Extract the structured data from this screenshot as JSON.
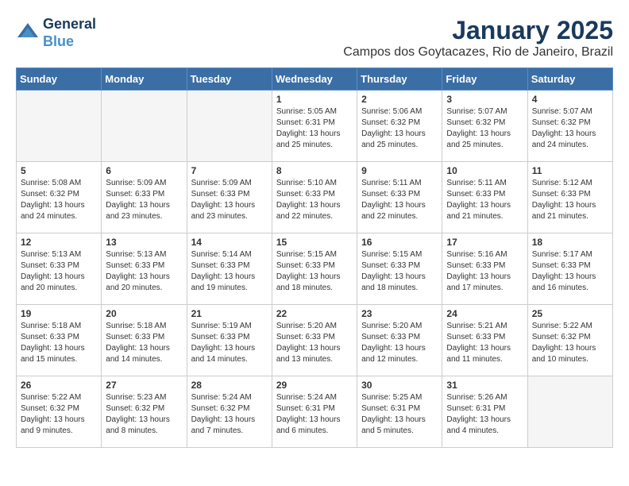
{
  "header": {
    "logo_line1": "General",
    "logo_line2": "Blue",
    "month_title": "January 2025",
    "location": "Campos dos Goytacazes, Rio de Janeiro, Brazil"
  },
  "weekdays": [
    "Sunday",
    "Monday",
    "Tuesday",
    "Wednesday",
    "Thursday",
    "Friday",
    "Saturday"
  ],
  "weeks": [
    [
      {
        "day": "",
        "info": ""
      },
      {
        "day": "",
        "info": ""
      },
      {
        "day": "",
        "info": ""
      },
      {
        "day": "1",
        "info": "Sunrise: 5:05 AM\nSunset: 6:31 PM\nDaylight: 13 hours\nand 25 minutes."
      },
      {
        "day": "2",
        "info": "Sunrise: 5:06 AM\nSunset: 6:32 PM\nDaylight: 13 hours\nand 25 minutes."
      },
      {
        "day": "3",
        "info": "Sunrise: 5:07 AM\nSunset: 6:32 PM\nDaylight: 13 hours\nand 25 minutes."
      },
      {
        "day": "4",
        "info": "Sunrise: 5:07 AM\nSunset: 6:32 PM\nDaylight: 13 hours\nand 24 minutes."
      }
    ],
    [
      {
        "day": "5",
        "info": "Sunrise: 5:08 AM\nSunset: 6:32 PM\nDaylight: 13 hours\nand 24 minutes."
      },
      {
        "day": "6",
        "info": "Sunrise: 5:09 AM\nSunset: 6:33 PM\nDaylight: 13 hours\nand 23 minutes."
      },
      {
        "day": "7",
        "info": "Sunrise: 5:09 AM\nSunset: 6:33 PM\nDaylight: 13 hours\nand 23 minutes."
      },
      {
        "day": "8",
        "info": "Sunrise: 5:10 AM\nSunset: 6:33 PM\nDaylight: 13 hours\nand 22 minutes."
      },
      {
        "day": "9",
        "info": "Sunrise: 5:11 AM\nSunset: 6:33 PM\nDaylight: 13 hours\nand 22 minutes."
      },
      {
        "day": "10",
        "info": "Sunrise: 5:11 AM\nSunset: 6:33 PM\nDaylight: 13 hours\nand 21 minutes."
      },
      {
        "day": "11",
        "info": "Sunrise: 5:12 AM\nSunset: 6:33 PM\nDaylight: 13 hours\nand 21 minutes."
      }
    ],
    [
      {
        "day": "12",
        "info": "Sunrise: 5:13 AM\nSunset: 6:33 PM\nDaylight: 13 hours\nand 20 minutes."
      },
      {
        "day": "13",
        "info": "Sunrise: 5:13 AM\nSunset: 6:33 PM\nDaylight: 13 hours\nand 20 minutes."
      },
      {
        "day": "14",
        "info": "Sunrise: 5:14 AM\nSunset: 6:33 PM\nDaylight: 13 hours\nand 19 minutes."
      },
      {
        "day": "15",
        "info": "Sunrise: 5:15 AM\nSunset: 6:33 PM\nDaylight: 13 hours\nand 18 minutes."
      },
      {
        "day": "16",
        "info": "Sunrise: 5:15 AM\nSunset: 6:33 PM\nDaylight: 13 hours\nand 18 minutes."
      },
      {
        "day": "17",
        "info": "Sunrise: 5:16 AM\nSunset: 6:33 PM\nDaylight: 13 hours\nand 17 minutes."
      },
      {
        "day": "18",
        "info": "Sunrise: 5:17 AM\nSunset: 6:33 PM\nDaylight: 13 hours\nand 16 minutes."
      }
    ],
    [
      {
        "day": "19",
        "info": "Sunrise: 5:18 AM\nSunset: 6:33 PM\nDaylight: 13 hours\nand 15 minutes."
      },
      {
        "day": "20",
        "info": "Sunrise: 5:18 AM\nSunset: 6:33 PM\nDaylight: 13 hours\nand 14 minutes."
      },
      {
        "day": "21",
        "info": "Sunrise: 5:19 AM\nSunset: 6:33 PM\nDaylight: 13 hours\nand 14 minutes."
      },
      {
        "day": "22",
        "info": "Sunrise: 5:20 AM\nSunset: 6:33 PM\nDaylight: 13 hours\nand 13 minutes."
      },
      {
        "day": "23",
        "info": "Sunrise: 5:20 AM\nSunset: 6:33 PM\nDaylight: 13 hours\nand 12 minutes."
      },
      {
        "day": "24",
        "info": "Sunrise: 5:21 AM\nSunset: 6:33 PM\nDaylight: 13 hours\nand 11 minutes."
      },
      {
        "day": "25",
        "info": "Sunrise: 5:22 AM\nSunset: 6:32 PM\nDaylight: 13 hours\nand 10 minutes."
      }
    ],
    [
      {
        "day": "26",
        "info": "Sunrise: 5:22 AM\nSunset: 6:32 PM\nDaylight: 13 hours\nand 9 minutes."
      },
      {
        "day": "27",
        "info": "Sunrise: 5:23 AM\nSunset: 6:32 PM\nDaylight: 13 hours\nand 8 minutes."
      },
      {
        "day": "28",
        "info": "Sunrise: 5:24 AM\nSunset: 6:32 PM\nDaylight: 13 hours\nand 7 minutes."
      },
      {
        "day": "29",
        "info": "Sunrise: 5:24 AM\nSunset: 6:31 PM\nDaylight: 13 hours\nand 6 minutes."
      },
      {
        "day": "30",
        "info": "Sunrise: 5:25 AM\nSunset: 6:31 PM\nDaylight: 13 hours\nand 5 minutes."
      },
      {
        "day": "31",
        "info": "Sunrise: 5:26 AM\nSunset: 6:31 PM\nDaylight: 13 hours\nand 4 minutes."
      },
      {
        "day": "",
        "info": ""
      }
    ]
  ]
}
